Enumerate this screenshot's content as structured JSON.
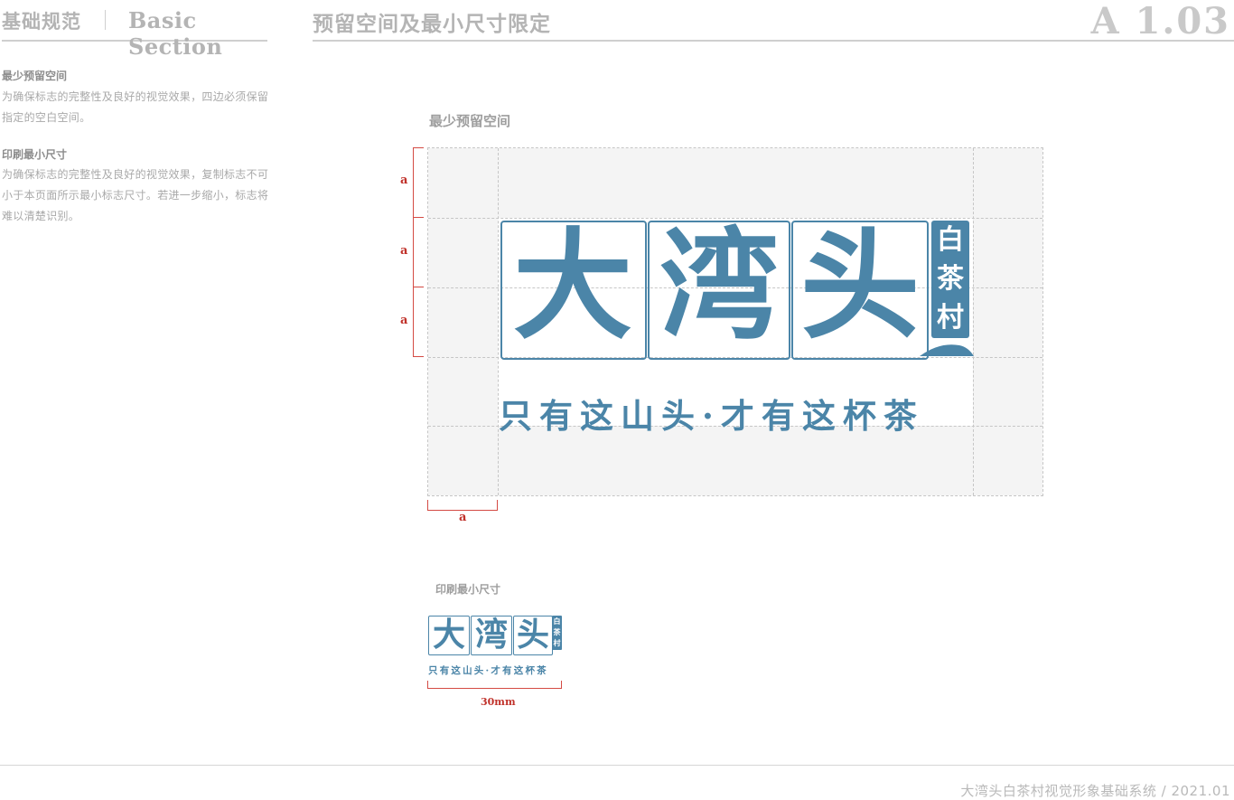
{
  "header": {
    "section_cn": "基础规范",
    "section_en": "Basic Section",
    "title": "预留空间及最小尺寸限定",
    "page_code": "A 1.03"
  },
  "sidebar": {
    "block1_title": "最少预留空间",
    "block1_body": "为确保标志的完整性及良好的视觉效果，四边必须保留指定的空白空间。",
    "block2_title": "印刷最小尺寸",
    "block2_body": "为确保标志的完整性及良好的视觉效果，复制标志不可小于本页面所示最小标志尺寸。若进一步缩小，标志将难以清楚识别。"
  },
  "clearspace": {
    "caption": "最少预留空间",
    "unit_label": "a"
  },
  "logo": {
    "char1": "大",
    "char2": "湾",
    "char3": "头",
    "seal": [
      "白",
      "茶",
      "村"
    ],
    "slogan": "只有这山头·才有这杯茶"
  },
  "minsize": {
    "caption": "印刷最小尺寸",
    "dimension": "30mm"
  },
  "footer": {
    "text": "大湾头白茶村视觉形象基础系统  /  2021.01"
  },
  "colors": {
    "brand_blue": "#4b85a8",
    "marker_red": "#c0322b"
  }
}
